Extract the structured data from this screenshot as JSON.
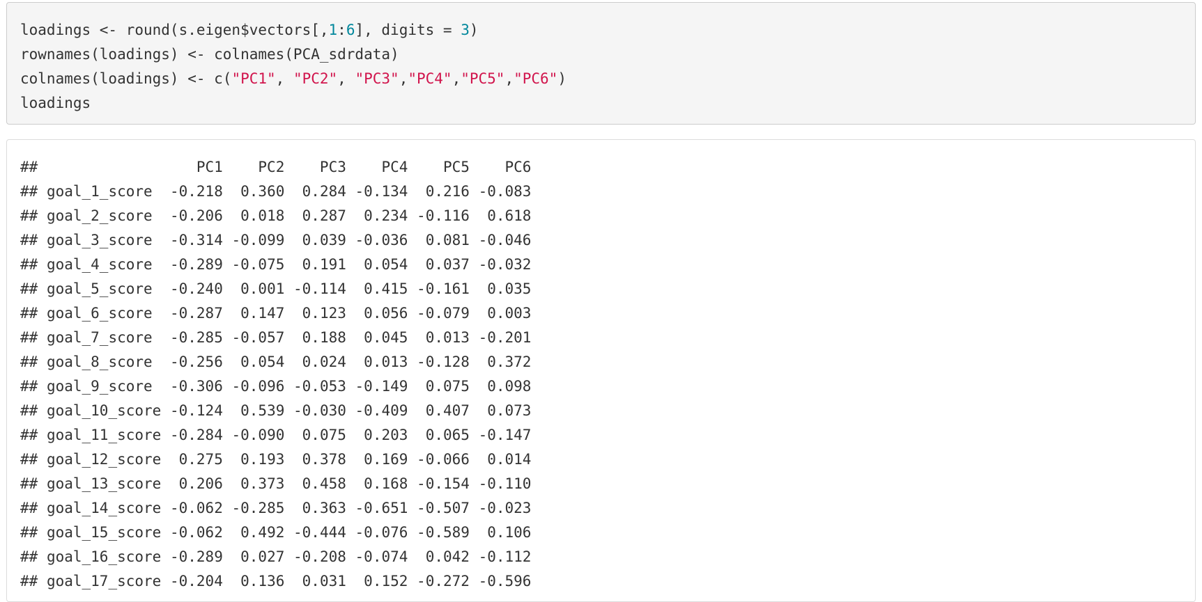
{
  "code": {
    "lines": [
      [
        {
          "text": "loadings <- round(s.eigen$vectors[,",
          "kind": "plain"
        },
        {
          "text": "1",
          "kind": "num"
        },
        {
          "text": ":",
          "kind": "plain"
        },
        {
          "text": "6",
          "kind": "num"
        },
        {
          "text": "], digits = ",
          "kind": "plain"
        },
        {
          "text": "3",
          "kind": "num"
        },
        {
          "text": ")",
          "kind": "plain"
        }
      ],
      [
        {
          "text": "rownames(loadings) <- colnames(PCA_sdrdata)",
          "kind": "plain"
        }
      ],
      [
        {
          "text": "colnames(loadings) <- c(",
          "kind": "plain"
        },
        {
          "text": "\"PC1\"",
          "kind": "str"
        },
        {
          "text": ", ",
          "kind": "plain"
        },
        {
          "text": "\"PC2\"",
          "kind": "str"
        },
        {
          "text": ", ",
          "kind": "plain"
        },
        {
          "text": "\"PC3\"",
          "kind": "str"
        },
        {
          "text": ",",
          "kind": "plain"
        },
        {
          "text": "\"PC4\"",
          "kind": "str"
        },
        {
          "text": ",",
          "kind": "plain"
        },
        {
          "text": "\"PC5\"",
          "kind": "str"
        },
        {
          "text": ",",
          "kind": "plain"
        },
        {
          "text": "\"PC6\"",
          "kind": "str"
        },
        {
          "text": ")",
          "kind": "plain"
        }
      ],
      [
        {
          "text": "loadings",
          "kind": "plain"
        }
      ]
    ]
  },
  "output": {
    "prefix": "##",
    "headers": [
      "PC1",
      "PC2",
      "PC3",
      "PC4",
      "PC5",
      "PC6"
    ],
    "rows": [
      {
        "name": "goal_1_score",
        "values": [
          "-0.218",
          "0.360",
          "0.284",
          "-0.134",
          "0.216",
          "-0.083"
        ]
      },
      {
        "name": "goal_2_score",
        "values": [
          "-0.206",
          "0.018",
          "0.287",
          "0.234",
          "-0.116",
          "0.618"
        ]
      },
      {
        "name": "goal_3_score",
        "values": [
          "-0.314",
          "-0.099",
          "0.039",
          "-0.036",
          "0.081",
          "-0.046"
        ]
      },
      {
        "name": "goal_4_score",
        "values": [
          "-0.289",
          "-0.075",
          "0.191",
          "0.054",
          "0.037",
          "-0.032"
        ]
      },
      {
        "name": "goal_5_score",
        "values": [
          "-0.240",
          "0.001",
          "-0.114",
          "0.415",
          "-0.161",
          "0.035"
        ]
      },
      {
        "name": "goal_6_score",
        "values": [
          "-0.287",
          "0.147",
          "0.123",
          "0.056",
          "-0.079",
          "0.003"
        ]
      },
      {
        "name": "goal_7_score",
        "values": [
          "-0.285",
          "-0.057",
          "0.188",
          "0.045",
          "0.013",
          "-0.201"
        ]
      },
      {
        "name": "goal_8_score",
        "values": [
          "-0.256",
          "0.054",
          "0.024",
          "0.013",
          "-0.128",
          "0.372"
        ]
      },
      {
        "name": "goal_9_score",
        "values": [
          "-0.306",
          "-0.096",
          "-0.053",
          "-0.149",
          "0.075",
          "0.098"
        ]
      },
      {
        "name": "goal_10_score",
        "values": [
          "-0.124",
          "0.539",
          "-0.030",
          "-0.409",
          "0.407",
          "0.073"
        ]
      },
      {
        "name": "goal_11_score",
        "values": [
          "-0.284",
          "-0.090",
          "0.075",
          "0.203",
          "0.065",
          "-0.147"
        ]
      },
      {
        "name": "goal_12_score",
        "values": [
          "0.275",
          "0.193",
          "0.378",
          "0.169",
          "-0.066",
          "0.014"
        ]
      },
      {
        "name": "goal_13_score",
        "values": [
          "0.206",
          "0.373",
          "0.458",
          "0.168",
          "-0.154",
          "-0.110"
        ]
      },
      {
        "name": "goal_14_score",
        "values": [
          "-0.062",
          "-0.285",
          "0.363",
          "-0.651",
          "-0.507",
          "-0.023"
        ]
      },
      {
        "name": "goal_15_score",
        "values": [
          "-0.062",
          "0.492",
          "-0.444",
          "-0.076",
          "-0.589",
          "0.106"
        ]
      },
      {
        "name": "goal_16_score",
        "values": [
          "-0.289",
          "0.027",
          "-0.208",
          "-0.074",
          "0.042",
          "-0.112"
        ]
      },
      {
        "name": "goal_17_score",
        "values": [
          "-0.204",
          "0.136",
          "0.031",
          "0.152",
          "-0.272",
          "-0.596"
        ]
      }
    ]
  },
  "colors": {
    "number": "#00879c",
    "string": "#d1144c",
    "text": "#333333",
    "code_bg": "#f5f5f5"
  }
}
